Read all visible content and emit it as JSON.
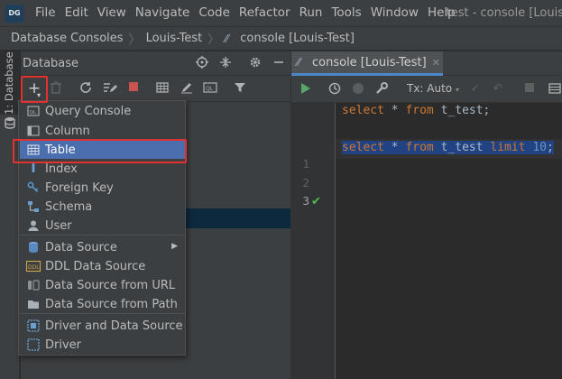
{
  "menubar": {
    "logo": "DG",
    "items": [
      "File",
      "Edit",
      "View",
      "Navigate",
      "Code",
      "Refactor",
      "Run",
      "Tools",
      "Window",
      "Help"
    ],
    "window_title": "test - console [Louis"
  },
  "breadcrumb": {
    "items": [
      "Database Consoles",
      "Louis-Test",
      "console [Louis-Test]"
    ]
  },
  "left_strip": {
    "tab_label": "1: Database"
  },
  "db_panel": {
    "title": "Database",
    "icons": {
      "header": [
        "crosshair-icon",
        "collapse-icon",
        "gear-icon",
        "minimize-icon"
      ],
      "toolbar": [
        "add-icon",
        "delete-icon",
        "refresh-icon",
        "edit-properties-icon",
        "stop-icon",
        "table-icon",
        "edit-icon",
        "console-icon",
        "filter-icon"
      ]
    }
  },
  "popup_menu": {
    "items": [
      {
        "label": "Query Console",
        "icon": "query-console-icon"
      },
      {
        "label": "Column",
        "icon": "column-icon"
      },
      {
        "label": "Table",
        "icon": "table-icon",
        "selected": true
      },
      {
        "label": "Index",
        "icon": "index-icon"
      },
      {
        "label": "Foreign Key",
        "icon": "foreign-key-icon"
      },
      {
        "label": "Schema",
        "icon": "schema-icon"
      },
      {
        "label": "User",
        "icon": "user-icon"
      },
      {
        "label": "Data Source",
        "icon": "data-source-icon",
        "submenu": true
      },
      {
        "label": "DDL Data Source",
        "icon": "ddl-icon"
      },
      {
        "label": "Data Source from URL",
        "icon": "url-icon"
      },
      {
        "label": "Data Source from Path",
        "icon": "folder-icon"
      },
      {
        "label": "Driver and Data Source",
        "icon": "driver-datasource-icon"
      },
      {
        "label": "Driver",
        "icon": "driver-icon"
      }
    ]
  },
  "editor": {
    "tab_label": "console [Louis-Test]",
    "tx_mode": "Tx: Auto",
    "line_numbers": [
      "1",
      "2",
      "3"
    ],
    "colors": {
      "keyword": "#cc7832",
      "number": "#6897bb",
      "text": "#a9b7c6",
      "selection": "#214283"
    },
    "lines": [
      [
        {
          "t": "select",
          "c": "kw"
        },
        {
          "t": " * "
        },
        {
          "t": "from",
          "c": "kw"
        },
        {
          "t": " t_test;"
        }
      ],
      [],
      [
        {
          "t": "select",
          "c": "kw"
        },
        {
          "t": " * "
        },
        {
          "t": "from",
          "c": "kw"
        },
        {
          "t": " t_test "
        },
        {
          "t": "limit",
          "c": "kw"
        },
        {
          "t": " "
        },
        {
          "t": "10",
          "c": "num"
        },
        {
          "t": ";"
        }
      ]
    ]
  },
  "highlight_color": "#e53030"
}
